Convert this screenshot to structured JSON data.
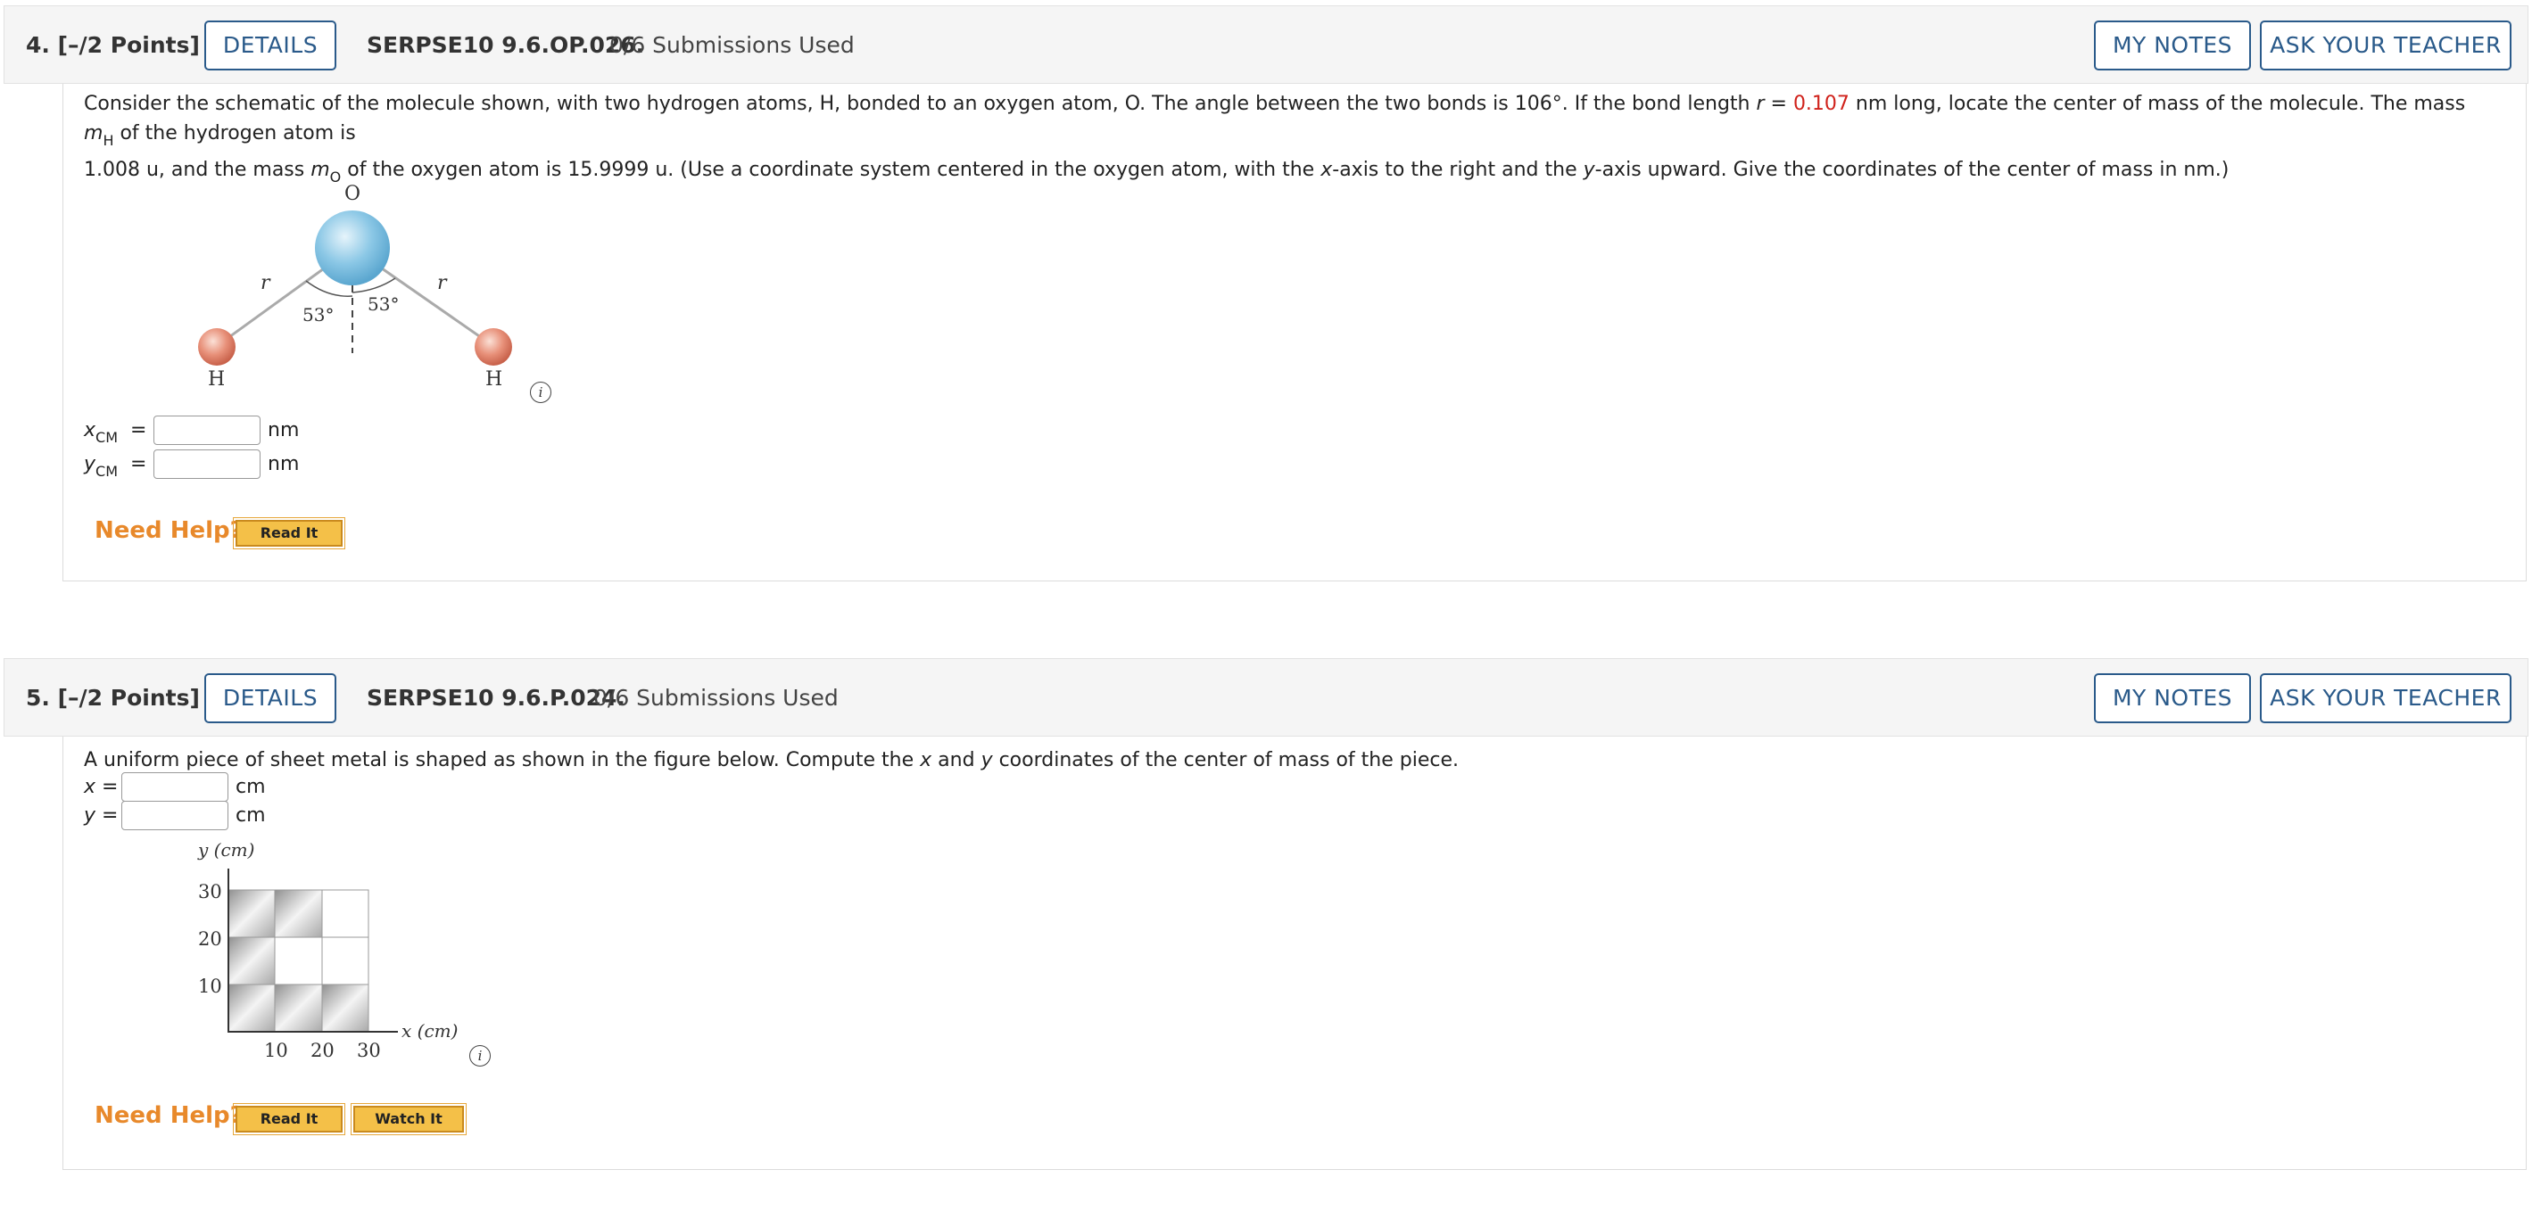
{
  "question4": {
    "number": "4.",
    "points": "[–/2 Points]",
    "details_label": "DETAILS",
    "code": "SERPSE10 9.6.OP.026.",
    "submissions": "0/6 Submissions Used",
    "my_notes_label": "MY NOTES",
    "ask_teacher_label": "ASK YOUR TEACHER",
    "prompt": {
      "part1": "Consider the schematic of the molecule shown, with two hydrogen atoms, H, bonded to an oxygen atom, O. The angle between the two bonds is 106°. If the bond length ",
      "r_symbol": "r",
      "equals": " = ",
      "r_value": "0.107",
      "part2": " nm long, locate the center of mass of the molecule. The mass ",
      "mH_symbol": "m",
      "mH_sub": "H",
      "part3": " of the hydrogen atom is",
      "line2a": "1.008 u, and the mass ",
      "mO_symbol": "m",
      "mO_sub": "O",
      "line2b": " of the oxygen atom is 15.9999 u. (Use a coordinate system centered in the oxygen atom, with the ",
      "x_sym": "x",
      "line2c": "-axis to the right and the ",
      "y_sym": "y",
      "line2d": "-axis upward. Give the coordinates of the center of mass in nm.)"
    },
    "figure": {
      "o_label": "O",
      "h_left_label": "H",
      "h_right_label": "H",
      "r_left_label": "r",
      "r_right_label": "r",
      "angle_left_label": "53°",
      "angle_right_label": "53°",
      "info_glyph": "i",
      "oxygen_color": "#8cc8e6",
      "hydrogen_color": "#e8917a"
    },
    "answers": {
      "xcm_symbol": "x",
      "xcm_sub": "CM",
      "ycm_symbol": "y",
      "ycm_sub": "CM",
      "equals": "=",
      "xcm_value": "",
      "ycm_value": "",
      "unit": "nm"
    },
    "need_help_label": "Need Help?",
    "read_it_label": "Read It"
  },
  "question5": {
    "number": "5.",
    "points": "[–/2 Points]",
    "details_label": "DETAILS",
    "code": "SERPSE10 9.6.P.024.",
    "submissions": "0/6 Submissions Used",
    "my_notes_label": "MY NOTES",
    "ask_teacher_label": "ASK YOUR TEACHER",
    "prompt": {
      "part1": "A uniform piece of sheet metal is shaped as shown in the figure below. Compute the ",
      "x_sym": "x",
      "and": " and ",
      "y_sym": "y",
      "part2": " coordinates of the center of mass of the piece."
    },
    "answers": {
      "x_label": "x =",
      "y_label": "y =",
      "x_value": "",
      "y_value": "",
      "unit": "cm"
    },
    "figure": {
      "y_axis_label": "y (cm)",
      "x_axis_label": "x (cm)",
      "y_ticks": [
        "30",
        "20",
        "10"
      ],
      "x_ticks": [
        "10",
        "20",
        "30"
      ],
      "info_glyph": "i",
      "metal_color": "#c8c8c8"
    },
    "need_help_label": "Need Help?",
    "read_it_label": "Read It",
    "watch_it_label": "Watch It"
  }
}
